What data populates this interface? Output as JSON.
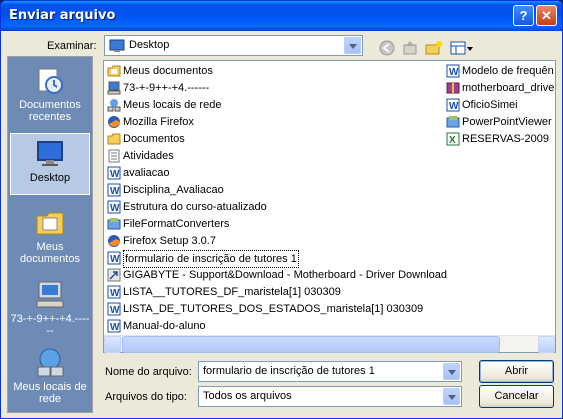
{
  "window": {
    "title": "Enviar arquivo"
  },
  "toolbar": {
    "look_in_label": "Examinar:",
    "look_in_value": "Desktop",
    "back_icon": "back-icon",
    "up_icon": "up-folder-icon",
    "new_folder_icon": "new-folder-icon",
    "views_icon": "views-menu-icon"
  },
  "places": [
    {
      "label": "Documentos recentes",
      "icon": "recent-documents-icon"
    },
    {
      "label": "Desktop",
      "icon": "desktop-icon",
      "selected": true
    },
    {
      "label": "Meus documentos",
      "icon": "my-documents-icon"
    },
    {
      "label": "73-+-9++-+4.------",
      "icon": "my-computer-icon"
    },
    {
      "label": "Meus locais de rede",
      "icon": "network-places-icon"
    }
  ],
  "files_col1": [
    {
      "name": "Meus documentos",
      "icon": "my-documents-icon"
    },
    {
      "name": "73-+-9++-+4.------",
      "icon": "my-computer-icon"
    },
    {
      "name": "Meus locais de rede",
      "icon": "network-places-icon"
    },
    {
      "name": "Mozilla Firefox",
      "icon": "firefox-icon"
    },
    {
      "name": "Documentos",
      "icon": "folder-icon"
    },
    {
      "name": "Atividades",
      "icon": "text-file-icon"
    },
    {
      "name": "avaliacao",
      "icon": "word-doc-icon"
    },
    {
      "name": "Disciplina_Avaliacao",
      "icon": "word-doc-icon"
    },
    {
      "name": "Estrutura do curso-atualizado",
      "icon": "word-doc-icon"
    },
    {
      "name": "FileFormatConverters",
      "icon": "installer-icon"
    },
    {
      "name": "Firefox Setup 3.0.7",
      "icon": "firefox-setup-icon"
    },
    {
      "name": "formulario de inscrição de tutores 1",
      "icon": "word-doc-icon",
      "selected": true
    },
    {
      "name": "GIGABYTE - Support&Download - Motherboard - Driver Download",
      "icon": "shortcut-icon"
    },
    {
      "name": "LISTA__TUTORES_DF_maristela[1] 030309",
      "icon": "word-doc-icon"
    },
    {
      "name": "LISTA_DE_TUTORES_DOS_ESTADOS_maristela[1] 030309",
      "icon": "word-doc-icon"
    },
    {
      "name": "Manual-do-aluno",
      "icon": "word-doc-icon"
    }
  ],
  "files_col2": [
    {
      "name": "Modelo de frequên",
      "icon": "word-doc-icon"
    },
    {
      "name": "motherboard_drive",
      "icon": "archive-icon"
    },
    {
      "name": "OficioSimei",
      "icon": "word-doc-icon"
    },
    {
      "name": "PowerPointViewer",
      "icon": "installer-icon"
    },
    {
      "name": "RESERVAS-2009",
      "icon": "excel-icon"
    }
  ],
  "filename": {
    "label": "Nome do arquivo:",
    "value": "formulario de inscrição de tutores 1"
  },
  "filetype": {
    "label": "Arquivos do tipo:",
    "value": "Todos os arquivos"
  },
  "buttons": {
    "open": "Abrir",
    "cancel": "Cancelar"
  }
}
